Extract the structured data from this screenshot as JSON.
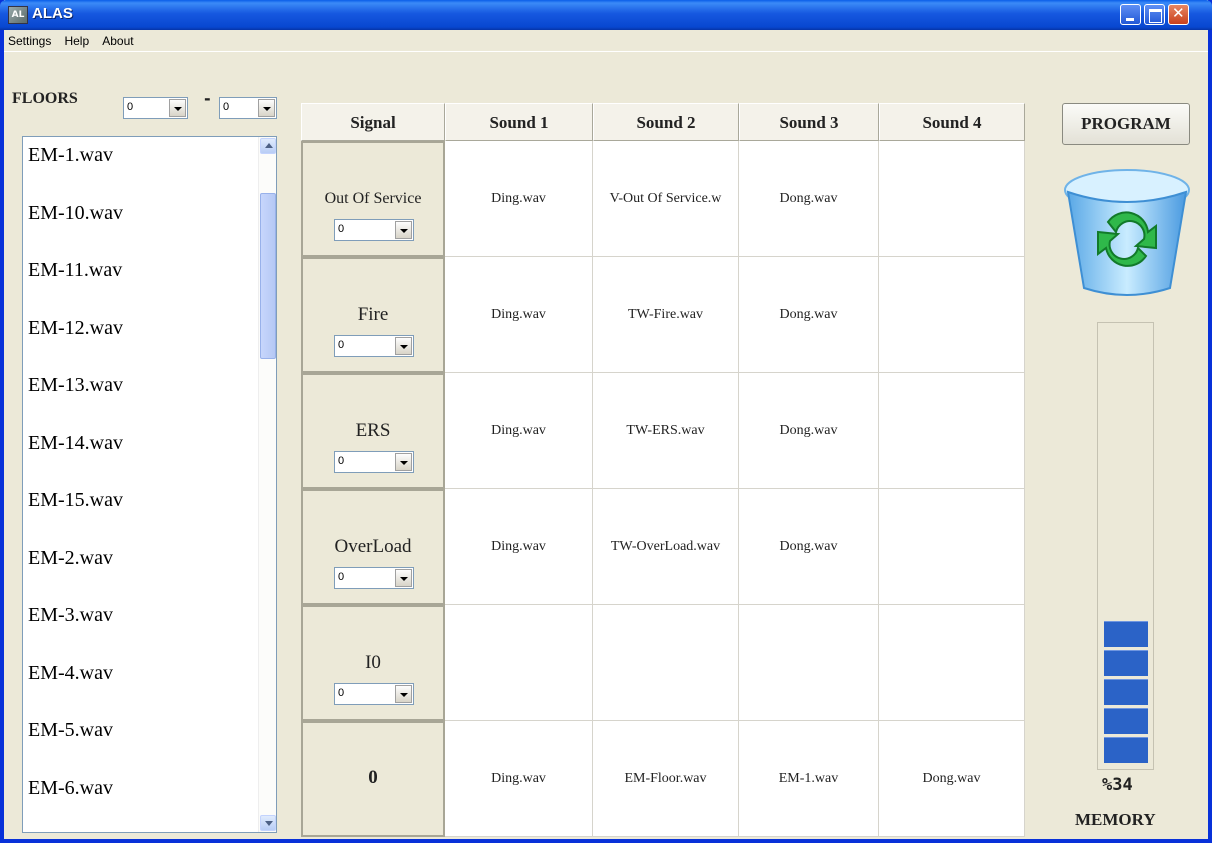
{
  "window": {
    "title": "ALAS",
    "icon_text": "AL"
  },
  "menu": {
    "items": [
      "Settings",
      "Help",
      "About"
    ]
  },
  "floors": {
    "label": "FLOORS",
    "separator": "-",
    "from_value": "0",
    "to_value": "0"
  },
  "files": [
    "EM-1.wav",
    "EM-10.wav",
    "EM-11.wav",
    "EM-12.wav",
    "EM-13.wav",
    "EM-14.wav",
    "EM-15.wav",
    "EM-2.wav",
    "EM-3.wav",
    "EM-4.wav",
    "EM-5.wav",
    "EM-6.wav"
  ],
  "grid": {
    "headers": [
      "Signal",
      "Sound 1",
      "Sound 2",
      "Sound 3",
      "Sound 4"
    ],
    "rows": [
      {
        "signal": "Out Of Service",
        "combo": "0",
        "sounds": [
          "Ding.wav",
          "V-Out Of Service.w",
          "Dong.wav",
          ""
        ]
      },
      {
        "signal": "Fire",
        "combo": "0",
        "sounds": [
          "Ding.wav",
          "TW-Fire.wav",
          "Dong.wav",
          ""
        ]
      },
      {
        "signal": "ERS",
        "combo": "0",
        "sounds": [
          "Ding.wav",
          "TW-ERS.wav",
          "Dong.wav",
          ""
        ]
      },
      {
        "signal": "OverLoad",
        "combo": "0",
        "sounds": [
          "Ding.wav",
          "TW-OverLoad.wav",
          "Dong.wav",
          ""
        ]
      },
      {
        "signal": "I0",
        "combo": "0",
        "sounds": [
          "",
          "",
          "",
          ""
        ]
      },
      {
        "signal": "0",
        "combo": null,
        "sounds": [
          "Ding.wav",
          "EM-Floor.wav",
          "EM-1.wav",
          "Dong.wav"
        ]
      }
    ]
  },
  "right_panel": {
    "program_label": "PROGRAM",
    "recycle_icon": "recycle-bin-refresh-icon",
    "memory_percent": "%34",
    "memory_label": "MEMORY",
    "memory_blocks_filled": 5
  },
  "colors": {
    "title_bar": "#0a5ee8",
    "memory_block": "#2b63c7",
    "window_bg": "#ece9d8"
  }
}
